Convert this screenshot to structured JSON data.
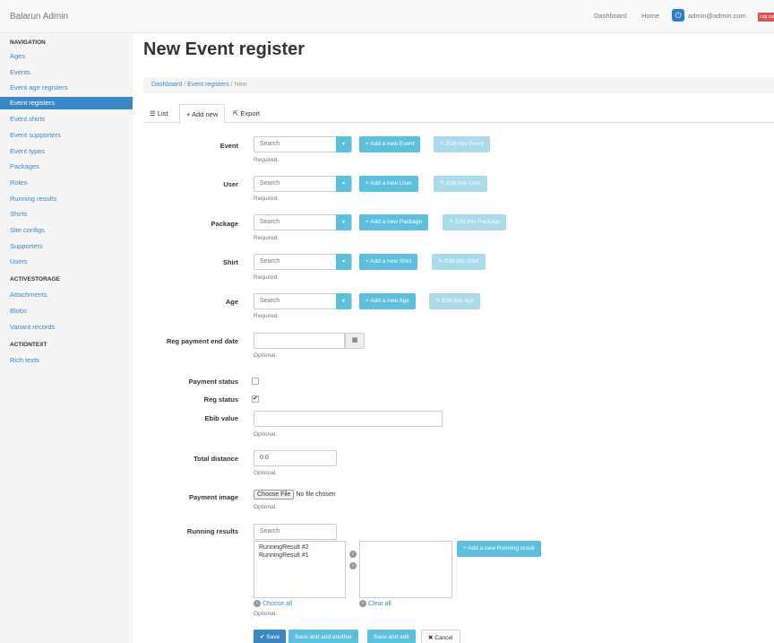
{
  "app": {
    "brand": "Balarun Admin"
  },
  "topnav": {
    "dashboard": "Dashboard",
    "home": "Home",
    "power_icon": "⏻",
    "user_email": "admin@admin.com",
    "logout": "Log out"
  },
  "sidebar": {
    "navigation_heading": "NAVIGATION",
    "navigation_items": [
      "Ages",
      "Events",
      "Event age registers",
      "Event registers",
      "Event shirts",
      "Event supporters",
      "Event types",
      "Packages",
      "Roles",
      "Running results",
      "Shirts",
      "Site configs",
      "Supporters",
      "Users"
    ],
    "active_item": "Event registers",
    "activestorage_heading": "ACTIVESTORAGE",
    "activestorage_items": [
      "Attachments",
      "Blobs",
      "Variant records"
    ],
    "actiontext_heading": "ACTIONTEXT",
    "actiontext_items": [
      "Rich texts"
    ]
  },
  "page": {
    "title": "New Event register"
  },
  "breadcrumb": {
    "dashboard": "Dashboard",
    "section": "Event registers",
    "current": "New",
    "sep": "/"
  },
  "tabs": {
    "list": "List",
    "add_new": "Add new",
    "export": "Export"
  },
  "form": {
    "search_placeholder": "Search",
    "required": "Required.",
    "optional": "Optional.",
    "event": {
      "label": "Event",
      "add": "+ Add a new Event",
      "edit": "✎ Edit this Event"
    },
    "user": {
      "label": "User",
      "add": "+ Add a new User",
      "edit": "✎ Edit this User"
    },
    "package": {
      "label": "Package",
      "add": "+ Add a new Package",
      "edit": "✎ Edit this Package"
    },
    "shirt": {
      "label": "Shirt",
      "add": "+ Add a new Shirt",
      "edit": "✎ Edit this Shirt"
    },
    "age": {
      "label": "Age",
      "add": "+ Add a new Age",
      "edit": "✎ Edit this Age"
    },
    "reg_payment_end_date": {
      "label": "Reg payment end date",
      "value": ""
    },
    "payment_status": {
      "label": "Payment status",
      "checked": false
    },
    "reg_status": {
      "label": "Reg status",
      "checked": true,
      "mark": "✔"
    },
    "ebib_value": {
      "label": "Ebib value",
      "value": ""
    },
    "total_distance": {
      "label": "Total distance",
      "value": "0.0"
    },
    "payment_image": {
      "label": "Payment image",
      "choose": "Choose File",
      "no_file": "No file chosen"
    },
    "running_results": {
      "label": "Running results",
      "search": "Search",
      "options": [
        "RunningResult #2",
        "RunningResult #1"
      ],
      "add": "+ Add a new Running result",
      "choose_all": "Choose all",
      "clear_all": "Clear all"
    }
  },
  "actions": {
    "save": "✔ Save",
    "save_add_another": "Save and add another",
    "save_edit": "Save and edit",
    "cancel": "✖ Cancel"
  },
  "colors": {
    "primary": "#3a87c8",
    "info": "#5bc0de",
    "danger": "#d9534f"
  }
}
